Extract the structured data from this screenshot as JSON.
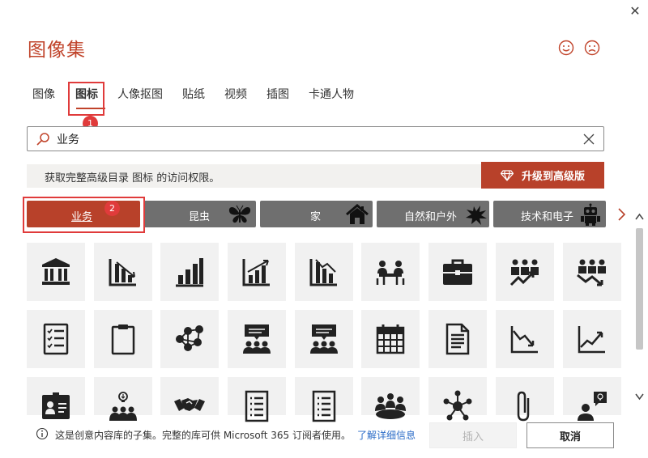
{
  "dialog": {
    "title": "图像集",
    "close_label": "✕"
  },
  "tabs": [
    {
      "label": "图像",
      "active": false
    },
    {
      "label": "图标",
      "active": true
    },
    {
      "label": "人像抠图",
      "active": false
    },
    {
      "label": "贴纸",
      "active": false
    },
    {
      "label": "视频",
      "active": false
    },
    {
      "label": "插图",
      "active": false
    },
    {
      "label": "卡通人物",
      "active": false
    }
  ],
  "annotations": {
    "badge_1": "1",
    "badge_2": "2"
  },
  "search": {
    "value": "业务",
    "placeholder": ""
  },
  "premium": {
    "message": "获取完整高级目录 图标 的访问权限。",
    "upgrade_label": "升级到高级版"
  },
  "categories": [
    {
      "label": "业务",
      "active": true,
      "icon": ""
    },
    {
      "label": "昆虫",
      "active": false,
      "icon": "butterfly-icon"
    },
    {
      "label": "家",
      "active": false,
      "icon": "house-icon"
    },
    {
      "label": "自然和户外",
      "active": false,
      "icon": "splat-icon"
    },
    {
      "label": "技术和电子",
      "active": false,
      "icon": "robot-icon"
    }
  ],
  "icons_grid": [
    [
      "bank-icon",
      "bar-chart-down-icon",
      "bar-chart-up-icon",
      "bar-chart-trend-up-icon",
      "bar-chart-trend-down-icon",
      "meeting-table-icon",
      "briefcase-icon",
      "team-growth-icon",
      "team-decline-icon"
    ],
    [
      "checklist-icon",
      "clipboard-icon",
      "network-people-icon",
      "presentation-audience-icon",
      "presentation-audience-icon",
      "calendar-icon",
      "document-icon",
      "line-chart-down-icon",
      "line-chart-up-icon"
    ],
    [
      "id-badge-icon",
      "idea-team-icon",
      "handshake-icon",
      "list-document-icon",
      "list-document-icon",
      "conference-icon",
      "network-hub-icon",
      "paperclip-icon",
      "idea-person-icon"
    ]
  ],
  "footer": {
    "info_text": "这是创意内容库的子集。完整的库可供 Microsoft 365 订阅者使用。",
    "link_text": "了解详细信息",
    "insert_label": "插入",
    "cancel_label": "取消"
  },
  "colors": {
    "accent": "#b8412a",
    "category_bg": "#6f6f6f",
    "highlight": "#e03b3b",
    "link": "#2a6bc7"
  }
}
